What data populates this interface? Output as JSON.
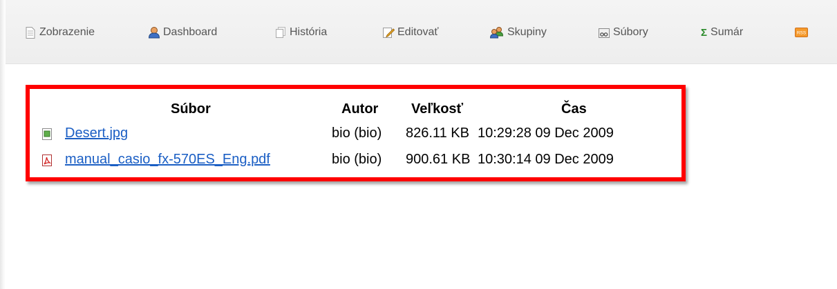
{
  "toolbar": {
    "items": [
      {
        "label": "Zobrazenie",
        "icon": "document-icon"
      },
      {
        "label": "Dashboard",
        "icon": "user-icon"
      },
      {
        "label": "História",
        "icon": "history-icon"
      },
      {
        "label": "Editovať",
        "icon": "edit-icon"
      },
      {
        "label": "Skupiny",
        "icon": "group-icon"
      },
      {
        "label": "Súbory",
        "icon": "files-icon"
      },
      {
        "label": "Sumár",
        "icon": "sigma-icon"
      }
    ],
    "rss_label": "RSS"
  },
  "files": {
    "headers": {
      "file": "Súbor",
      "author": "Autor",
      "size": "Veľkosť",
      "time": "Čas"
    },
    "rows": [
      {
        "name": "Desert.jpg",
        "author": "bio (bio)",
        "size": "826.11 KB",
        "time": "10:29:28 09 Dec 2009",
        "icon": "image-file-icon"
      },
      {
        "name": "manual_casio_fx-570ES_Eng.pdf",
        "author": "bio (bio)",
        "size": "900.61 KB",
        "time": "10:30:14 09 Dec 2009",
        "icon": "pdf-file-icon"
      }
    ]
  },
  "colors": {
    "highlight_border": "#ff0000",
    "link": "#1a5ec4"
  }
}
